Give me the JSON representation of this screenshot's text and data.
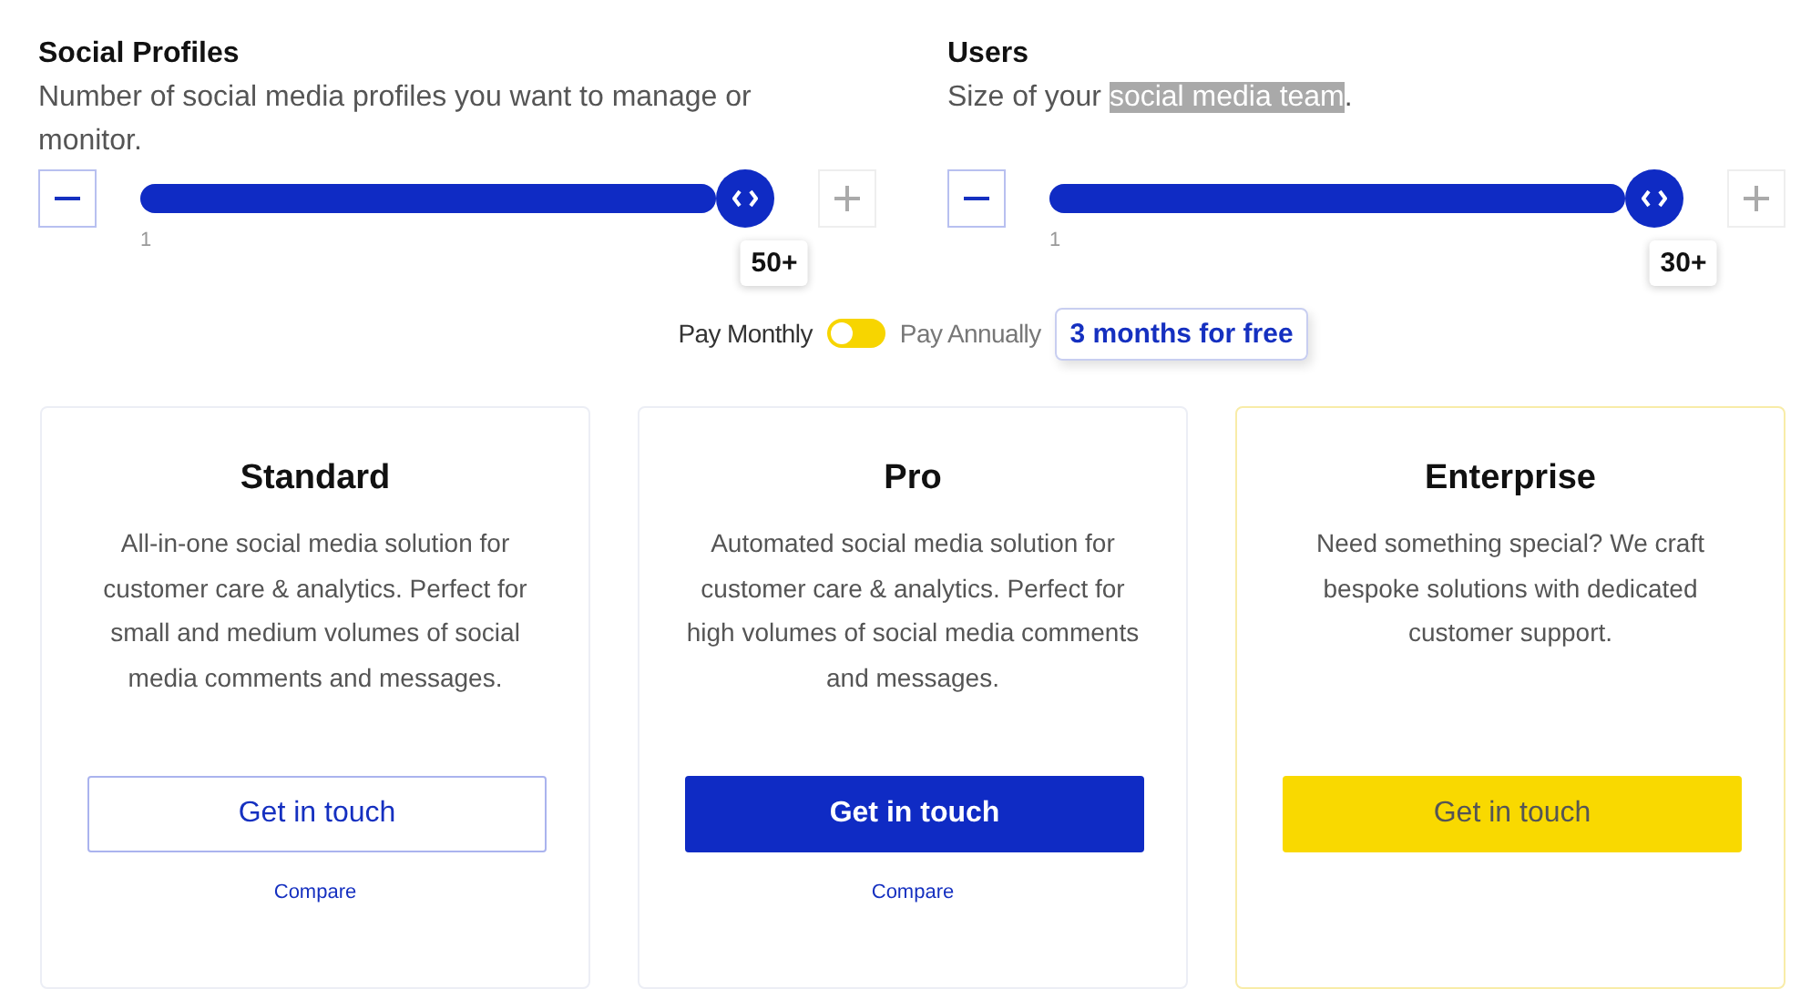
{
  "sliders": [
    {
      "title": "Social Profiles",
      "description": [
        {
          "text": "Number of social media profiles you want to manage or monitor.",
          "highlighted": false
        }
      ],
      "min_label": "1",
      "value": "50+",
      "level": 1
    },
    {
      "title": "Users",
      "description": [
        {
          "text": "Size of your ",
          "highlighted": false
        },
        {
          "text": "social media team",
          "highlighted": true
        },
        {
          "text": ".",
          "highlighted": false
        }
      ],
      "min_label": "1",
      "value": "30+",
      "level": 1
    }
  ],
  "billing": {
    "monthly_label": "Pay Monthly",
    "annual_label": "Pay Annually",
    "annual": false,
    "offer": "3 months for free"
  },
  "plans": [
    {
      "name": "Standard",
      "description": "All-in-one social media solution for customer care & analytics. Perfect for small and medium volumes of social media comments and messages.",
      "button": "Get in touch",
      "kind": "outline",
      "compare": "Compare"
    },
    {
      "name": "Pro",
      "description": "Automated social media solution for customer care & analytics. Perfect for high volumes of social media comments and messages.",
      "button": "Get in touch",
      "kind": "solid",
      "compare": "Compare"
    },
    {
      "name": "Enterprise",
      "description": "Need something special? We craft bespoke solutions with dedicated customer support.",
      "button": "Get in touch",
      "kind": "yellow"
    }
  ]
}
